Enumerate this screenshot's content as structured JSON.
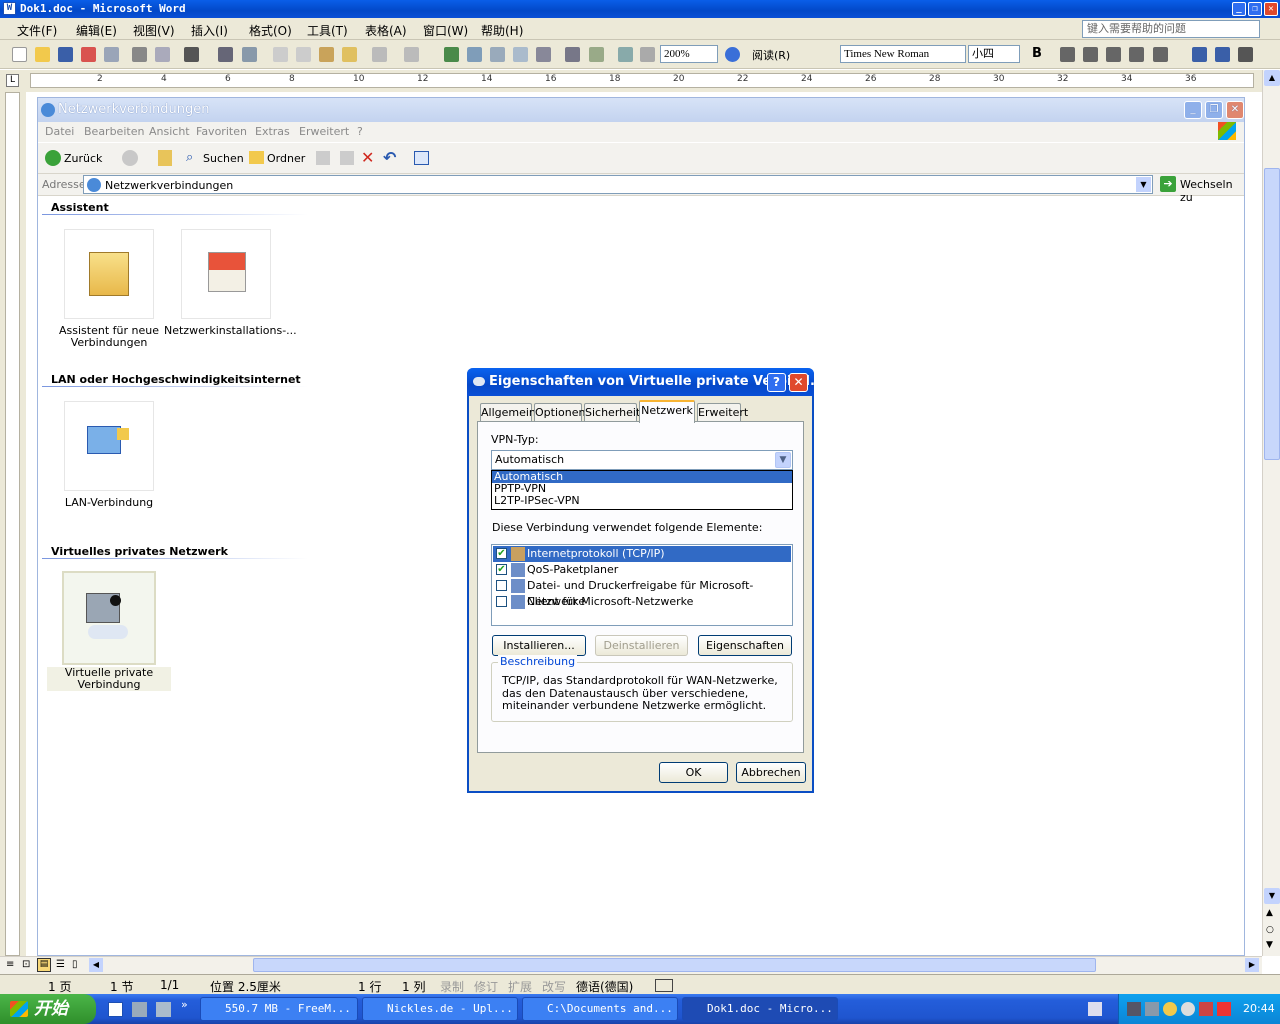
{
  "word": {
    "title": "Dok1.doc - Microsoft Word",
    "menu": [
      "文件(F)",
      "编辑(E)",
      "视图(V)",
      "插入(I)",
      "格式(O)",
      "工具(T)",
      "表格(A)",
      "窗口(W)",
      "帮助(H)"
    ],
    "help_placeholder": "键入需要帮助的问题",
    "zoom": "200%",
    "read_label": "阅读(R)",
    "font_name": "Times New Roman",
    "font_size": "小四",
    "bold_label": "B",
    "ruler_numbers": [
      "2",
      "4",
      "6",
      "8",
      "10",
      "12",
      "14",
      "16",
      "18",
      "20",
      "22",
      "24",
      "26",
      "28",
      "30",
      "32",
      "34",
      "36"
    ],
    "status": {
      "page": "1 页",
      "section": "1 节",
      "pages": "1/1",
      "position": "位置 2.5厘米",
      "line": "1 行",
      "column": "1 列",
      "rec": "录制",
      "trk": "修订",
      "ext": "扩展",
      "ovr": "改写",
      "lang": "德语(德国)"
    }
  },
  "explorer": {
    "title": "Netzwerkverbindungen",
    "menu": [
      "Datei",
      "Bearbeiten",
      "Ansicht",
      "Favoriten",
      "Extras",
      "Erweitert",
      "?"
    ],
    "toolbar": {
      "back": "Zurück",
      "search": "Suchen",
      "folders": "Ordner"
    },
    "address_label": "Adresse",
    "address_value": "Netzwerkverbindungen",
    "go_label": "Wechseln zu",
    "sections": {
      "wizard": "Assistent",
      "lan": "LAN oder Hochgeschwindigkeitsinternet",
      "vpn": "Virtuelles privates Netzwerk"
    },
    "items": {
      "new_connection": "Assistent für neue Verbindungen",
      "network_setup": "Netzwerkinstallations-...",
      "lan_connection": "LAN-Verbindung",
      "vpn_connection": "Virtuelle private Verbindung"
    }
  },
  "dialog": {
    "title": "Eigenschaften von Virtuelle private Verbind...",
    "help_btn": "?",
    "close_btn": "✕",
    "tabs": [
      "Allgemein",
      "Optionen",
      "Sicherheit",
      "Netzwerk",
      "Erweitert"
    ],
    "active_tab": "Netzwerk",
    "vpn_type_label": "VPN-Typ:",
    "vpn_type_value": "Automatisch",
    "vpn_type_options": [
      "Automatisch",
      "PPTP-VPN",
      "L2TP-IPSec-VPN"
    ],
    "elements_label": "Diese Verbindung verwendet folgende Elemente:",
    "components": [
      {
        "label": "Internetprotokoll (TCP/IP)",
        "checked": true
      },
      {
        "label": "QoS-Paketplaner",
        "checked": true
      },
      {
        "label": "Datei- und Druckerfreigabe für Microsoft-Netzwerke",
        "checked": false
      },
      {
        "label": "Client für Microsoft-Netzwerke",
        "checked": false
      }
    ],
    "buttons": {
      "install": "Installieren...",
      "uninstall": "Deinstallieren",
      "properties": "Eigenschaften",
      "ok": "OK",
      "cancel": "Abbrechen"
    },
    "description_title": "Beschreibung",
    "description_text": "TCP/IP, das Standardprotokoll für WAN-Netzwerke, das den Datenaustausch über verschiedene, miteinander verbundene Netzwerke ermöglicht."
  },
  "taskbar": {
    "start": "开始",
    "tasks": [
      "550.7 MB - FreeM...",
      "Nickles.de - Upl...",
      "C:\\Documents and...",
      "Dok1.doc - Micro..."
    ],
    "clock": "20:44"
  },
  "colors": {
    "xp_blue": "#0a4fd6",
    "selection": "#316ac5",
    "tab_hot": "#f8b433",
    "start_green": "#2f8f2b"
  }
}
